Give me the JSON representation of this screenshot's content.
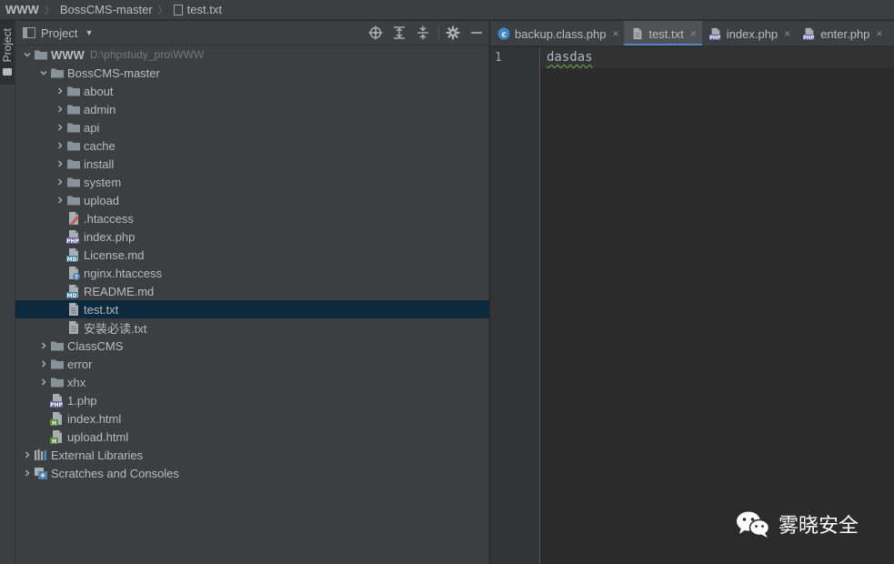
{
  "breadcrumb": {
    "root": "WWW",
    "project": "BossCMS-master",
    "file": "test.txt"
  },
  "toolstrip": {
    "project_label": "Project"
  },
  "panel": {
    "title": "Project",
    "icons": [
      "crosshair-icon",
      "expand-all-icon",
      "collapse-all-icon",
      "gear-icon",
      "minimize-icon"
    ]
  },
  "tree": [
    {
      "label": "WWW",
      "path": "D:\\phpstudy_pro\\WWW",
      "depth": 0,
      "arrow": "down",
      "icon": "folder",
      "bold": true
    },
    {
      "label": "BossCMS-master",
      "depth": 1,
      "arrow": "down",
      "icon": "folder"
    },
    {
      "label": "about",
      "depth": 2,
      "arrow": "right",
      "icon": "folder"
    },
    {
      "label": "admin",
      "depth": 2,
      "arrow": "right",
      "icon": "folder"
    },
    {
      "label": "api",
      "depth": 2,
      "arrow": "right",
      "icon": "folder"
    },
    {
      "label": "cache",
      "depth": 2,
      "arrow": "right",
      "icon": "folder"
    },
    {
      "label": "install",
      "depth": 2,
      "arrow": "right",
      "icon": "folder"
    },
    {
      "label": "system",
      "depth": 2,
      "arrow": "right",
      "icon": "folder"
    },
    {
      "label": "upload",
      "depth": 2,
      "arrow": "right",
      "icon": "folder"
    },
    {
      "label": ".htaccess",
      "depth": 2,
      "arrow": "none",
      "icon": "htaccess"
    },
    {
      "label": "index.php",
      "depth": 2,
      "arrow": "none",
      "icon": "php"
    },
    {
      "label": "License.md",
      "depth": 2,
      "arrow": "none",
      "icon": "md"
    },
    {
      "label": "nginx.htaccess",
      "depth": 2,
      "arrow": "none",
      "icon": "unknown"
    },
    {
      "label": "README.md",
      "depth": 2,
      "arrow": "none",
      "icon": "md"
    },
    {
      "label": "test.txt",
      "depth": 2,
      "arrow": "none",
      "icon": "txt",
      "selected": true
    },
    {
      "label": "安装必读.txt",
      "depth": 2,
      "arrow": "none",
      "icon": "txt"
    },
    {
      "label": "ClassCMS",
      "depth": 1,
      "arrow": "right",
      "icon": "folder"
    },
    {
      "label": "error",
      "depth": 1,
      "arrow": "right",
      "icon": "folder"
    },
    {
      "label": "xhx",
      "depth": 1,
      "arrow": "right",
      "icon": "folder"
    },
    {
      "label": "1.php",
      "depth": 1,
      "arrow": "none",
      "icon": "php"
    },
    {
      "label": "index.html",
      "depth": 1,
      "arrow": "none",
      "icon": "html"
    },
    {
      "label": "upload.html",
      "depth": 1,
      "arrow": "none",
      "icon": "html"
    },
    {
      "label": "External Libraries",
      "depth": 0,
      "arrow": "right",
      "icon": "library"
    },
    {
      "label": "Scratches and Consoles",
      "depth": 0,
      "arrow": "right",
      "icon": "scratches"
    }
  ],
  "tabs": [
    {
      "label": "backup.class.php",
      "icon": "class",
      "active": false
    },
    {
      "label": "test.txt",
      "icon": "txt",
      "active": true
    },
    {
      "label": "index.php",
      "icon": "php",
      "active": false
    },
    {
      "label": "enter.php",
      "icon": "php",
      "active": false
    }
  ],
  "close_glyph": "×",
  "editor": {
    "line_number": "1",
    "content": "dasdas"
  },
  "watermark": {
    "text": "雾晓安全"
  },
  "colors": {
    "accent": "#4a88c7",
    "selection": "#0d293e",
    "folder": "#87939a"
  }
}
